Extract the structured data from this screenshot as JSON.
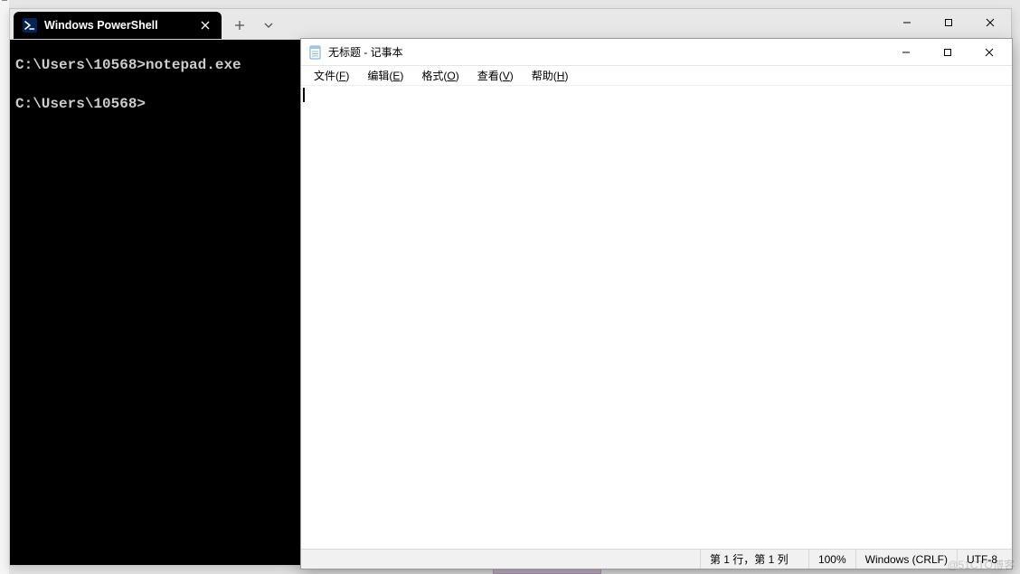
{
  "terminal": {
    "tab_title": "Windows PowerShell",
    "lines": [
      {
        "prompt": "C:\\Users\\10568>",
        "command": "notepad.exe"
      },
      {
        "prompt": "C:\\Users\\10568>",
        "command": ""
      }
    ]
  },
  "notepad": {
    "title": "无标题 - 记事本",
    "menu": {
      "file": {
        "label": "文件",
        "mn": "F"
      },
      "edit": {
        "label": "编辑",
        "mn": "E"
      },
      "format": {
        "label": "格式",
        "mn": "O"
      },
      "view": {
        "label": "查看",
        "mn": "V"
      },
      "help": {
        "label": "帮助",
        "mn": "H"
      }
    },
    "status": {
      "position": "第 1 行，第 1 列",
      "zoom": "100%",
      "eol": "Windows (CRLF)",
      "encoding": "UTF-8"
    }
  },
  "watermark": "@51CTO博客"
}
